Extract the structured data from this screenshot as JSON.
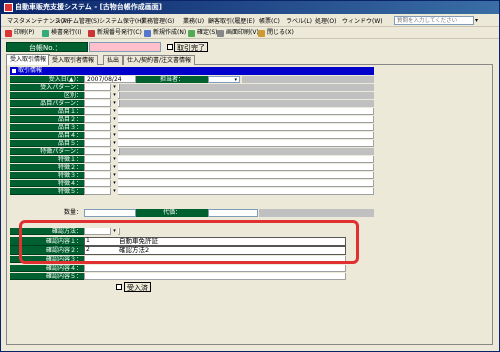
{
  "window": {
    "title": "自動車販売支援システム - [古物台帳作成画面]"
  },
  "menu": {
    "items": [
      "マスタメンテナンス(M)",
      "システム管理(S)",
      "システム保守(H)",
      "業務管理(G)",
      "業務(U)",
      "顧客取引(履歴(E)",
      "帳票(C)",
      "ラベル(L)",
      "処理(O)",
      "ウィンドウ(W)"
    ],
    "help_placeholder": "質問を入力してください"
  },
  "toolbar": {
    "items": [
      "印刷(P)",
      "検書発行(I)",
      "新規番号発行(C)",
      "新規作成(N)",
      "確定(S)",
      "画面印刷(V)",
      "閉じる(X)"
    ]
  },
  "ledger": {
    "label": "台帳No.：",
    "value": "",
    "complete_label": "取引完了"
  },
  "tabs": [
    "受入取引情報",
    "受入取引者情報",
    "払出",
    "仕入/契約書/注文書情報"
  ],
  "section": {
    "title": "取引情報"
  },
  "form": {
    "rows": [
      "受入日(▲)：",
      "受入パターン：",
      "区別：",
      "品目パターン：",
      "品目１：",
      "品目２：",
      "品目３：",
      "品目４：",
      "品目５：",
      "特徴パターン：",
      "特徴１：",
      "特徴２：",
      "特徴３：",
      "特徴４：",
      "特徴５：",
      "数量：",
      "",
      "確認方法：",
      "確認内容１：",
      "確認内容２：",
      "確認内容３：",
      "確認内容４：",
      "確認内容５："
    ],
    "date": "2007/08/24",
    "staff_label": "担当者：",
    "staff_value": "",
    "price_label": "代価：",
    "confirm1_num": "1",
    "confirm1_value": "自動車免許証",
    "confirm2_num": "2",
    "confirm2_value": "確認方法2",
    "received_label": "受入済"
  }
}
